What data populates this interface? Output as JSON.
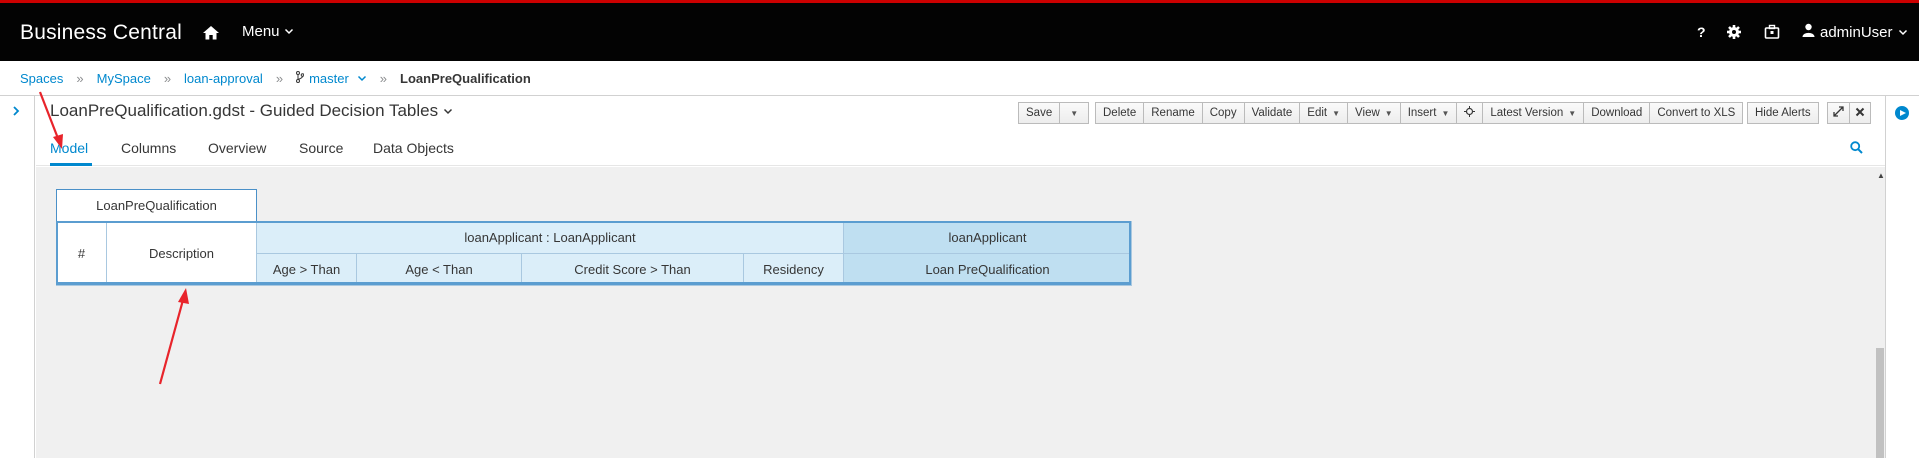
{
  "app": {
    "brand": "Business Central",
    "menu_label": "Menu",
    "user_label": "adminUser",
    "accent_color": "#cc0000",
    "link_color": "#0088ce",
    "top_icons": [
      "home-icon",
      "help-icon",
      "gear-icon",
      "briefcase-icon",
      "user-icon"
    ]
  },
  "breadcrumb": {
    "items": [
      "Spaces",
      "MySpace",
      "loan-approval",
      "master",
      "LoanPreQualification"
    ],
    "separator": "»"
  },
  "editor": {
    "title": "LoanPreQualification.gdst - Guided Decision Tables",
    "toolbar": {
      "save": "Save",
      "delete": "Delete",
      "rename": "Rename",
      "copy": "Copy",
      "validate": "Validate",
      "edit": "Edit",
      "view": "View",
      "insert": "Insert",
      "latest_version": "Latest Version",
      "download": "Download",
      "convert": "Convert to XLS",
      "hide_alerts": "Hide Alerts"
    },
    "tabs": [
      "Model",
      "Columns",
      "Overview",
      "Source",
      "Data Objects"
    ],
    "active_tab": "Model"
  },
  "decision_table": {
    "name": "LoanPreQualification",
    "row_number_header": "#",
    "description_header": "Description",
    "condition_group": "loanApplicant : LoanApplicant",
    "conditions": [
      "Age > Than",
      "Age < Than",
      "Credit Score > Than",
      "Residency"
    ],
    "action_group": "loanApplicant",
    "action": "Loan PreQualification",
    "colors": {
      "condition_fill": "#dbeef9",
      "action_fill": "#bfdff1",
      "border": "#5b9dd0"
    }
  },
  "annotations": {
    "arrow_color": "#e8242b"
  }
}
